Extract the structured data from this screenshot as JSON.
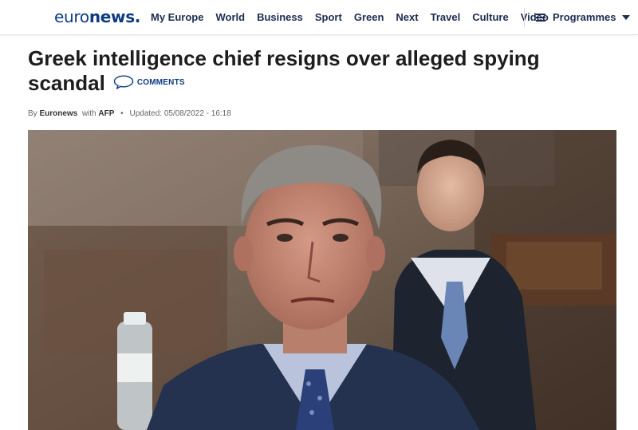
{
  "header": {
    "logo_light": "euro",
    "logo_bold": "news.",
    "nav": [
      "My Europe",
      "World",
      "Business",
      "Sport",
      "Green",
      "Next",
      "Travel",
      "Culture",
      "Video"
    ],
    "programmes_label": "Programmes"
  },
  "article": {
    "title": "Greek intelligence chief resigns over alleged spying scandal",
    "comments_label": "COMMENTS",
    "byline": {
      "by": "By",
      "author": "Euronews",
      "with": "with",
      "agency": "AFP",
      "separator": "•",
      "updated": "Updated: 05/08/2022 - 16:18"
    }
  },
  "colors": {
    "brand_blue": "#0c3b82",
    "nav_text": "#1d2b4f"
  },
  "icons": [
    "list-icon",
    "chevron-down-icon",
    "comment-bubble-icon"
  ]
}
